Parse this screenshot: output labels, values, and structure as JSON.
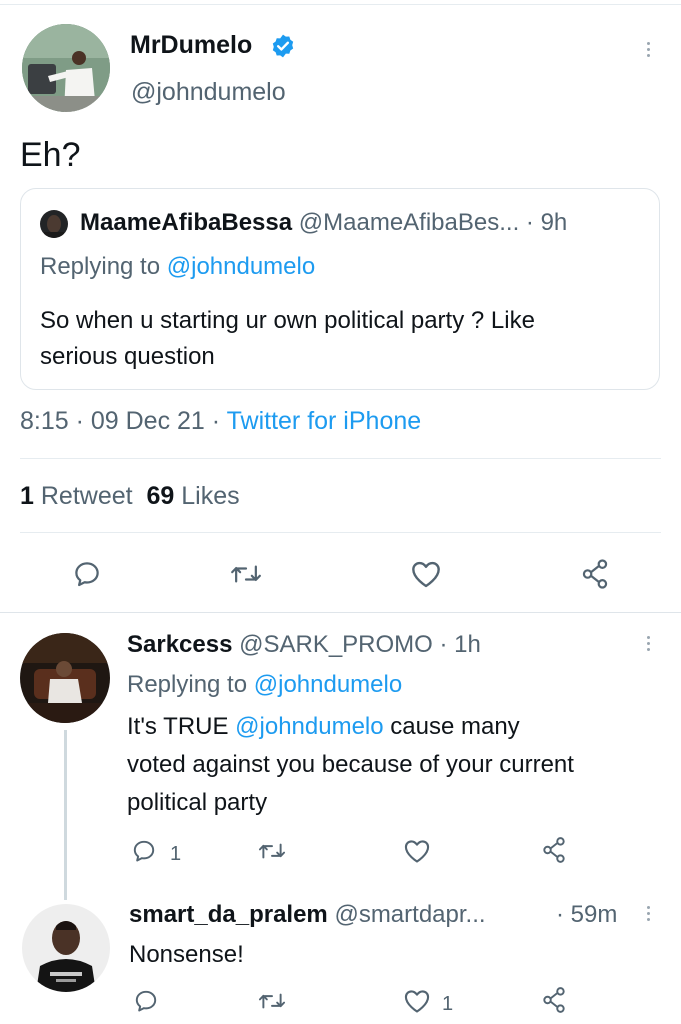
{
  "tweet": {
    "name": "MrDumelo",
    "handle": "@johndumelo",
    "text": "Eh?",
    "quote": {
      "name": "MaameAfibaBessa",
      "handle": "@MaameAfibaBes...",
      "time": "· 9h",
      "replying_prefix": "Replying to",
      "replying_handle": "@johndumelo",
      "text_line1": "So when u starting ur own political party ? Like",
      "text_line2": "serious question"
    },
    "meta_time": "8:15 · 09 Dec 21 ·",
    "meta_source": "Twitter for iPhone",
    "retweets_count": "1",
    "retweets_label": "Retweet",
    "likes_count": "69",
    "likes_label": "Likes"
  },
  "replies": [
    {
      "name": "Sarkcess",
      "handle": "@SARK_PROMO",
      "time": "· 1h",
      "replying_prefix": "Replying to",
      "replying_handle": "@johndumelo",
      "text_prefix": "It's TRUE",
      "mention": "@johndumelo",
      "text_after": "cause many",
      "text_line2": "voted against you because of your current",
      "text_line3": "political party",
      "reply_count": "1"
    },
    {
      "name": "smart_da_pralem",
      "handle": "@smartdapr...",
      "time": "· 59m",
      "text": "Nonsense!",
      "like_count": "1"
    }
  ],
  "colors": {
    "accent": "#1d9bf0",
    "verified": "#1d9bf0",
    "secondary_text": "#536471",
    "divider": "#e6ecf0"
  },
  "icons": [
    "verified-badge-icon",
    "more-options-icon",
    "reply-icon",
    "retweet-icon",
    "like-icon",
    "share-icon"
  ]
}
